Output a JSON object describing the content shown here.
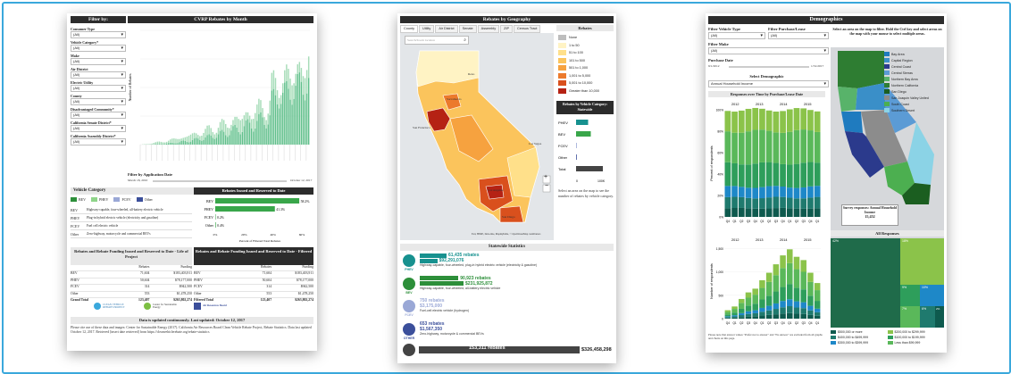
{
  "colors": {
    "frame": "#3aa8dc",
    "header": "#2c2c2c",
    "green": "#39a64a",
    "teal": "#17918f",
    "bev": "#2d8f3a",
    "phev": "#8fd48a",
    "fcev": "#9aa8d6",
    "other": "#3b4f9b"
  },
  "p1": {
    "filter_title": "Filter by:",
    "chart_title": "CVRP Rebates by Month",
    "filters": [
      {
        "label": "Consumer Type",
        "value": "(All)"
      },
      {
        "label": "Vehicle Category*",
        "value": "(All)"
      },
      {
        "label": "Make",
        "value": "(All)"
      },
      {
        "label": "Air District",
        "value": "(All)"
      },
      {
        "label": "Electric Utility",
        "value": "(All)"
      },
      {
        "label": "County",
        "value": "(All)"
      },
      {
        "label": "Disadvantaged Community*",
        "value": "(All)"
      },
      {
        "label": "California Senate District*",
        "value": "(All)"
      },
      {
        "label": "California Assembly District*",
        "value": "(All)"
      }
    ],
    "ylabel": "Number of Rebates",
    "app_date_label": "Filter by Application Date",
    "date_start": "March 18, 2010",
    "date_end": "October 12, 2017",
    "veh_cat_title": "Vehicle Category",
    "legend": [
      "BEV",
      "PHEV",
      "FCEV",
      "Other"
    ],
    "cat_table": [
      {
        "k": "BEV",
        "v": "Highway-capable, four-wheeled, all-battery electric vehicle"
      },
      {
        "k": "PHEV",
        "v": "Plug-in hybrid electric vehicle (electricity and gasoline)"
      },
      {
        "k": "FCEV",
        "v": "Fuel cell electric vehicle"
      },
      {
        "k": "Other",
        "v": "Zero-highway, motorcycle and commercial BEVs"
      }
    ],
    "issued_title": "Rebates Issued and Reserved to Date",
    "issued_bars": [
      {
        "k": "BEV",
        "pct": "58.2%",
        "v": 58.2
      },
      {
        "k": "PHEV",
        "pct": "41.3%",
        "v": 41.3
      },
      {
        "k": "FCEV",
        "pct": "0.2%",
        "v": 0.2
      },
      {
        "k": "Other",
        "pct": "0.4%",
        "v": 0.4
      }
    ],
    "issued_ticks": [
      "0%",
      "20%",
      "40%",
      "60%"
    ],
    "issued_xlabel": "Percent of Filtered Total Rebates",
    "funding_title_l": "Rebates and Rebate Funding Issued and Reserved to Date - Life of Project",
    "funding_title_r": "Rebates and Rebate Funding Issued and Reserved to Date - Filtered",
    "funding_cols": [
      "Rebates",
      "Funding"
    ],
    "funding_rows_l": [
      {
        "k": "BEV",
        "a": "71,604",
        "b": "$183,403,911"
      },
      {
        "k": "PHEV",
        "a": "50,604",
        "b": "$78,177,000"
      },
      {
        "k": "FCEV",
        "a": "314",
        "b": "$942,500"
      },
      {
        "k": "Other",
        "a": "553",
        "b": "$1,478,250"
      },
      {
        "k": "Grand Total",
        "a": "123,407",
        "b": "$263,802,274"
      }
    ],
    "funding_rows_r": [
      {
        "k": "BEV",
        "a": "71,604",
        "b": "$183,403,911"
      },
      {
        "k": "PHEV",
        "a": "50,604",
        "b": "$78,177,000"
      },
      {
        "k": "FCEV",
        "a": "314",
        "b": "$942,500"
      },
      {
        "k": "Other",
        "a": "553",
        "b": "$1,478,250"
      },
      {
        "k": "Filtered Total",
        "a": "123,407",
        "b": "$263,802,274"
      }
    ],
    "logos": [
      "CLEAN VEHICLE REBATE PROJECT",
      "Center for Sustainable Energy",
      "Air Resources Board"
    ],
    "updated": "Data is updated continuously. Last updated: October 12, 2017",
    "cite": "Please cite use of these data and images: Center for Sustainable Energy (2017). California Air Resources Board Clean Vehicle Rebate Project, Rebate Statistics. Data last updated October 12, 2017. Retrieved [insert date retrieved] from https://cleanvehiclerebate.org/rebate-statistics"
  },
  "p2": {
    "title": "Rebates by Geography",
    "tabs": [
      "County",
      "Utility",
      "Air District",
      "Senate",
      "Assembly",
      "ZIP",
      "Census Tract"
    ],
    "search_placeholder": "Search/Zoom location",
    "rebates_title": "Rebates",
    "legend": [
      {
        "label": "None",
        "color": "#bdbdbd"
      },
      {
        "label": "1 to 50",
        "color": "#fff3c4"
      },
      {
        "label": "51 to 100",
        "color": "#ffe08a"
      },
      {
        "label": "101 to 500",
        "color": "#fbc45c"
      },
      {
        "label": "501 to 1,000",
        "color": "#f6a23f"
      },
      {
        "label": "1,001 to 5,000",
        "color": "#ec7a2c"
      },
      {
        "label": "5,001 to 10,000",
        "color": "#d9501d"
      },
      {
        "label": "Greater than 10,000",
        "color": "#b52214"
      }
    ],
    "veh_cat_title": "Rebates by Vehicle Category: Statewide",
    "veh_bars": [
      {
        "k": "PHEV",
        "v": 0.45
      },
      {
        "k": "BEV",
        "v": 0.55
      },
      {
        "k": "FCEV",
        "v": 0.01
      },
      {
        "k": "Other",
        "v": 0.01
      },
      {
        "k": "Total",
        "v": 1.0
      }
    ],
    "veh_ticks": [
      "0",
      "100K"
    ],
    "select_note": "Select an area on the map to see the number of rebates by vehicle category.",
    "map_labels": [
      "Reno",
      "Sacramento",
      "San Francisco",
      "Las Vegas",
      "Los Angeles",
      "San Diego"
    ],
    "map_credit": "Esri, HERE, DeLorme, MapmyIndia, © OpenStreetMap contributors",
    "stats_title": "Statewide Statistics",
    "stats": [
      {
        "icon": "PHEV",
        "rebates": "61,435 rebates",
        "funding": "$92,291,076",
        "desc": "Highway-capable, four-wheeled, plug-in hybrid electric vehicle (electricity & gasoline)",
        "color": "#17918f",
        "w": 0.5,
        "w2": 0.28
      },
      {
        "icon": "BEV",
        "rebates": "90,923 rebates",
        "funding": "$231,925,872",
        "desc": "Highway-capable, four-wheeled, all-battery electric vehicle",
        "color": "#2d8f3a",
        "w": 0.72,
        "w2": 0.7
      },
      {
        "icon": "FCEV",
        "rebates": "750 rebates",
        "funding": "$3,175,000",
        "desc": "Fuel-cell electric vehicle (hydrogen)",
        "color": "#9aa8d6",
        "w": 0,
        "w2": 0
      },
      {
        "icon": "OTHER",
        "rebates": "653 rebates",
        "funding": "$1,567,350",
        "desc": "Zero-highway, motorcycle & commercial BEVs",
        "color": "#3b4f9b",
        "w": 0,
        "w2": 0
      }
    ],
    "total_rebates": "153,311 rebates",
    "total_funding": "$326,458,298"
  },
  "p3": {
    "title": "Demographics",
    "filter_vehicle_label": "Filter Vehicle Type",
    "filter_vehicle_value": "(All)",
    "filter_purchase_label": "Filter Purchase/Lease",
    "filter_purchase_value": "(All)",
    "filter_make_label": "Filter Make",
    "filter_make_value": "(All)",
    "purchase_date_label": "Purchase Date",
    "date_start": "9/1/2012",
    "date_end": "1/31/2017",
    "select_demo_label": "Select Demographic",
    "select_demo_value": "Annual Household Income",
    "map_instruction": "Select an area on the map to filter. Hold the Ctrl key and select areas on the map with your mouse to select multiple areas.",
    "regions": [
      {
        "label": "Bay Area",
        "color": "#1f7bbf"
      },
      {
        "label": "Capital Region",
        "color": "#3a8fc8"
      },
      {
        "label": "Central Coast",
        "color": "#2b3a8c"
      },
      {
        "label": "Central Sierras",
        "color": "#5b9bd5"
      },
      {
        "label": "Northern Bay Area",
        "color": "#58b36a"
      },
      {
        "label": "Northern California",
        "color": "#2e7d32"
      },
      {
        "label": "San Diego",
        "color": "#1b5e20"
      },
      {
        "label": "San Joaquin Valley United",
        "color": "#8c8c8c"
      },
      {
        "label": "South Coast",
        "color": "#4caf50"
      },
      {
        "label": "Southern Desert",
        "color": "#8bd3e6"
      }
    ],
    "survey_title": "Survey responses: Annual Household Income",
    "survey_count": "15,452",
    "resp_time_title": "Responses over Time by Purchase/Lease Date",
    "years": [
      "2012",
      "2013",
      "2014",
      "2015"
    ],
    "quarters": [
      "Q4",
      "Q1",
      "Q2",
      "Q3",
      "Q4",
      "Q1",
      "Q2",
      "Q3",
      "Q4",
      "Q1",
      "Q2",
      "Q3",
      "Q4",
      "Q1"
    ],
    "pct_ylabel": "Percent of respondents",
    "pct_ticks": [
      "100%",
      "80%",
      "60%",
      "40%",
      "20%",
      "0%"
    ],
    "count_ylabel": "Number of respondents",
    "count_ticks": [
      "1,500",
      "1,000",
      "500",
      "0"
    ],
    "count_values": [
      180,
      260,
      420,
      560,
      640,
      820,
      980,
      1160,
      1350,
      1480,
      1320,
      1250,
      980,
      760
    ],
    "all_resp_title": "All Responses",
    "all_resp_pcts": [
      "42%",
      "18%",
      "9%",
      "10%",
      "7%",
      "6%",
      "2%"
    ],
    "income_legend": [
      {
        "label": "$500,000 or more",
        "color": "#0e5a4e"
      },
      {
        "label": "$200,000 to $299,999",
        "color": "#8bc34a"
      },
      {
        "label": "$400,000 to $499,999",
        "color": "#1f7a6e"
      },
      {
        "label": "$100,000 to $199,999",
        "color": "#2e9e5b"
      },
      {
        "label": "$300,000 to $399,999",
        "color": "#1e88c8"
      },
      {
        "label": "Less than $99,999",
        "color": "#5ab85a"
      }
    ],
    "note": "Please note that answer values \"Prefer not to answer\" and \"No answer\" are excluded from all graphs and charts on this page."
  }
}
